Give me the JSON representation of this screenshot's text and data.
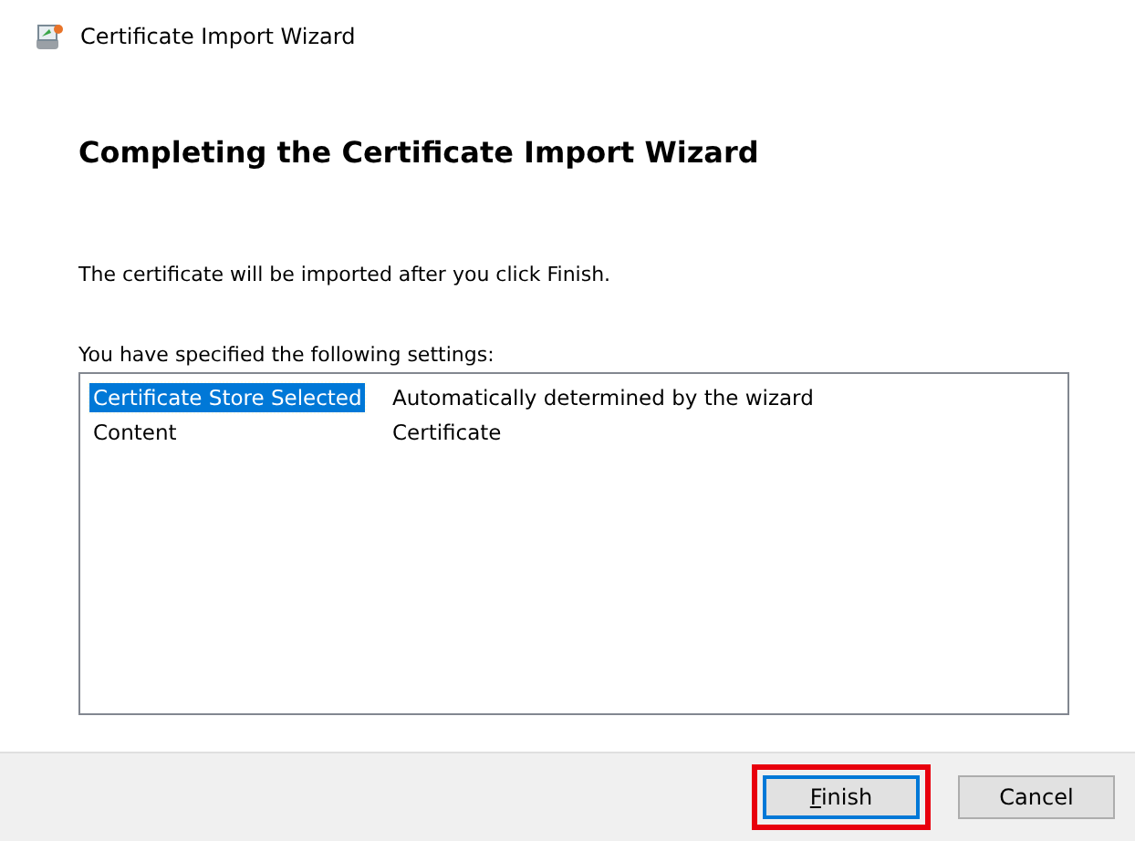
{
  "window": {
    "title": "Certificate Import Wizard"
  },
  "heading": "Completing the Certificate Import Wizard",
  "message": "The certificate will be imported after you click Finish.",
  "settings_label": "You have specified the following settings:",
  "settings": [
    {
      "name": "Certificate Store Selected",
      "value": "Automatically determined by the wizard",
      "selected": true
    },
    {
      "name": "Content",
      "value": "Certificate",
      "selected": false
    }
  ],
  "buttons": [
    {
      "label": "Finish",
      "default": true,
      "highlighted": true
    },
    {
      "label": "Cancel",
      "default": false,
      "highlighted": false
    }
  ]
}
